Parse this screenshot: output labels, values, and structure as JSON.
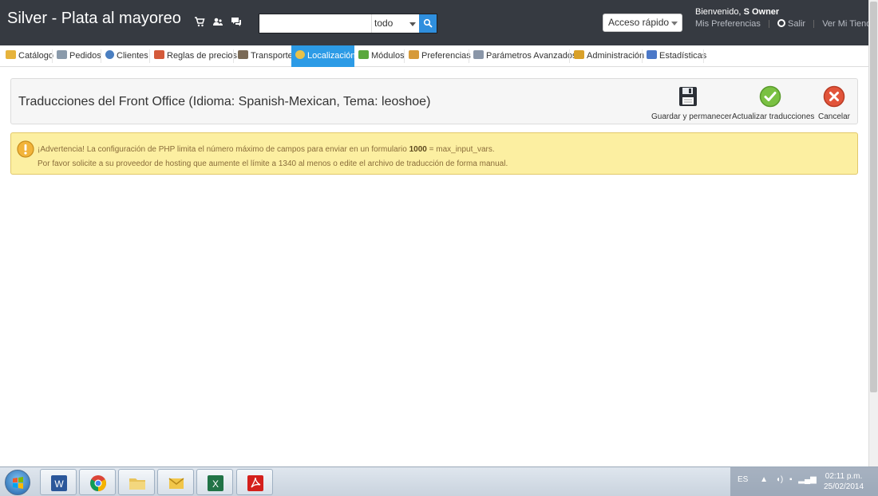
{
  "header": {
    "shop_title": "Silver - Plata al mayoreo",
    "search": {
      "value": "",
      "placeholder": "",
      "filter_selected": "todo"
    },
    "quick_access_label": "Acceso rápido",
    "welcome_prefix": "Bienvenido,",
    "welcome_user": "S Owner",
    "links": {
      "preferences": "Mis Preferencias",
      "logout": "Salir",
      "view_shop": "Ver Mi Tienda"
    }
  },
  "menu": {
    "items": [
      {
        "label": "Catálogo",
        "icon": "folder-icon",
        "color": "#e6b33c"
      },
      {
        "label": "Pedidos",
        "icon": "cart-icon",
        "color": "#8a9aab"
      },
      {
        "label": "Clientes",
        "icon": "user-icon",
        "color": "#4a7fc1"
      },
      {
        "label": "Reglas de precios",
        "icon": "price-rules-icon",
        "color": "#d45a3a"
      },
      {
        "label": "Transporte",
        "icon": "truck-icon",
        "color": "#7a6a56"
      },
      {
        "label": "Localización",
        "icon": "globe-icon",
        "color": "#e8c24a"
      },
      {
        "label": "Módulos",
        "icon": "puzzle-icon",
        "color": "#5aa83c"
      },
      {
        "label": "Preferencias",
        "icon": "preferences-icon",
        "color": "#d69a3a"
      },
      {
        "label": "Parámetros Avanzados",
        "icon": "wrench-icon",
        "color": "#8a96a8"
      },
      {
        "label": "Administración",
        "icon": "key-icon",
        "color": "#d9a12a"
      },
      {
        "label": "Estadísticas",
        "icon": "bar-chart-icon",
        "color": "#4b78c8"
      }
    ],
    "active_index": 5
  },
  "toolbar": {
    "title": "Traducciones del Front Office (Idioma: Spanish-Mexican, Tema: leoshoe)",
    "buttons": {
      "save_stay": "Guardar y permanecer",
      "update": "Actualizar traducciones",
      "cancel": "Cancelar"
    }
  },
  "warning": {
    "line1_prefix": "¡Advertencia! La configuración de PHP limita el número máximo de campos para enviar en un formulario",
    "line1_value": "1000",
    "line1_suffix": "= max_input_vars.",
    "line2": "Por favor solicite a su proveedor de hosting que aumente el límite a 1340 al menos o edite el archivo de traducción de forma manual."
  },
  "taskbar": {
    "apps": [
      "word-icon",
      "chrome-icon",
      "file-explorer-icon",
      "outlook-icon",
      "excel-icon",
      "acrobat-icon"
    ],
    "language": "ES",
    "time": "02:11 p.m.",
    "date": "25/02/2014"
  },
  "colors": {
    "header_bg": "#363a41",
    "active_tab": "#2c9be6",
    "warning_bg": "#fcefa1"
  }
}
